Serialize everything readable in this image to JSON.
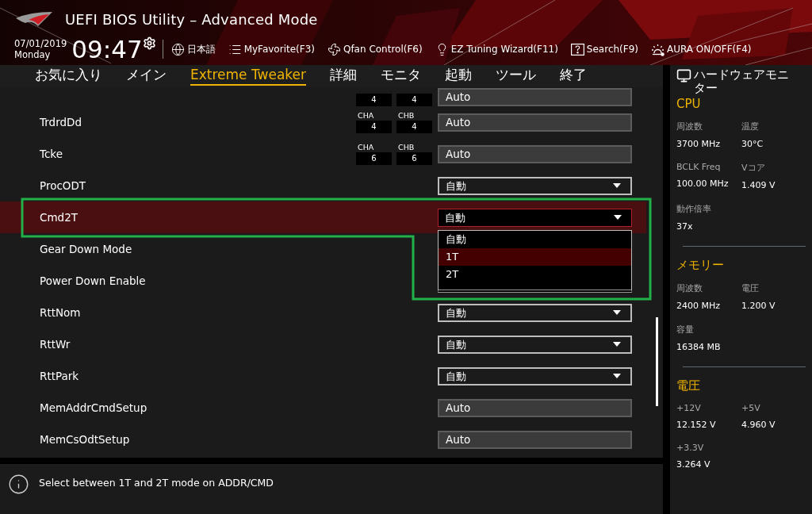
{
  "header": {
    "title": "UEFI BIOS Utility – Advanced Mode",
    "date": "07/01/2019",
    "day": "Monday",
    "time": "09:47",
    "language": "日本語",
    "tools": [
      {
        "label": "MyFavorite(F3)"
      },
      {
        "label": "Qfan Control(F6)"
      },
      {
        "label": "EZ Tuning Wizard(F11)"
      },
      {
        "label": "Search(F9)"
      },
      {
        "label": "AURA ON/OFF(F4)"
      }
    ]
  },
  "tabs": [
    {
      "label": "お気に入り",
      "selected": false
    },
    {
      "label": "メイン",
      "selected": false
    },
    {
      "label": "Extreme Tweaker",
      "selected": true
    },
    {
      "label": "詳細",
      "selected": false
    },
    {
      "label": "モニタ",
      "selected": false
    },
    {
      "label": "起動",
      "selected": false
    },
    {
      "label": "ツール",
      "selected": false
    },
    {
      "label": "終了",
      "selected": false
    }
  ],
  "settings": [
    {
      "kind": "channel",
      "cha_value": "4",
      "chb_value": "4",
      "value": "Auto",
      "selected": false
    },
    {
      "kind": "channel",
      "label": "TrdrdDd",
      "cha_label": "CHA",
      "chb_label": "CHB",
      "cha_value": "4",
      "chb_value": "4",
      "value": "Auto",
      "selected": false
    },
    {
      "kind": "channel",
      "label": "Tcke",
      "cha_label": "CHA",
      "chb_label": "CHB",
      "cha_value": "6",
      "chb_value": "6",
      "value": "Auto",
      "selected": false
    },
    {
      "kind": "select",
      "label": "ProcODT",
      "value": "自動",
      "selected": false,
      "open": false
    },
    {
      "kind": "select",
      "label": "Cmd2T",
      "value": "自動",
      "selected": true,
      "open": true,
      "options": [
        {
          "label": "自動",
          "highlighted": false
        },
        {
          "label": "1T",
          "highlighted": true
        },
        {
          "label": "2T",
          "highlighted": false
        }
      ]
    },
    {
      "kind": "label",
      "label": "Gear Down Mode",
      "selected": false
    },
    {
      "kind": "label",
      "label": "Power Down Enable",
      "selected": false
    },
    {
      "kind": "select",
      "label": "RttNom",
      "value": "自動",
      "selected": false,
      "open": false
    },
    {
      "kind": "select",
      "label": "RttWr",
      "value": "自動",
      "selected": false,
      "open": false
    },
    {
      "kind": "select",
      "label": "RttPark",
      "value": "自動",
      "selected": false,
      "open": false
    },
    {
      "kind": "text",
      "label": "MemAddrCmdSetup",
      "value": "Auto",
      "selected": false
    },
    {
      "kind": "text",
      "label": "MemCsOdtSetup",
      "value": "Auto",
      "selected": false
    }
  ],
  "help": "Select between 1T and 2T mode on ADDR/CMD",
  "hardware_monitor": {
    "title": "ハードウェアモニター",
    "sections": [
      {
        "title": "CPU",
        "items": [
          {
            "label": "周波数",
            "value": "3700 MHz"
          },
          {
            "label": "温度",
            "value": "30°C"
          },
          {
            "label": "BCLK Freq",
            "value": "100.00 MHz"
          },
          {
            "label": "Vコア",
            "value": "1.409 V"
          },
          {
            "label": "動作倍率",
            "value": "37x"
          }
        ]
      },
      {
        "title": "メモリー",
        "items": [
          {
            "label": "周波数",
            "value": "2400 MHz"
          },
          {
            "label": "電圧",
            "value": "1.200 V"
          },
          {
            "label": "容量",
            "value": "16384 MB"
          }
        ]
      },
      {
        "title": "電圧",
        "items": [
          {
            "label": "+12V",
            "value": "12.152 V"
          },
          {
            "label": "+5V",
            "value": "4.960 V"
          },
          {
            "label": "+3.3V",
            "value": "3.264 V"
          }
        ]
      }
    ]
  }
}
